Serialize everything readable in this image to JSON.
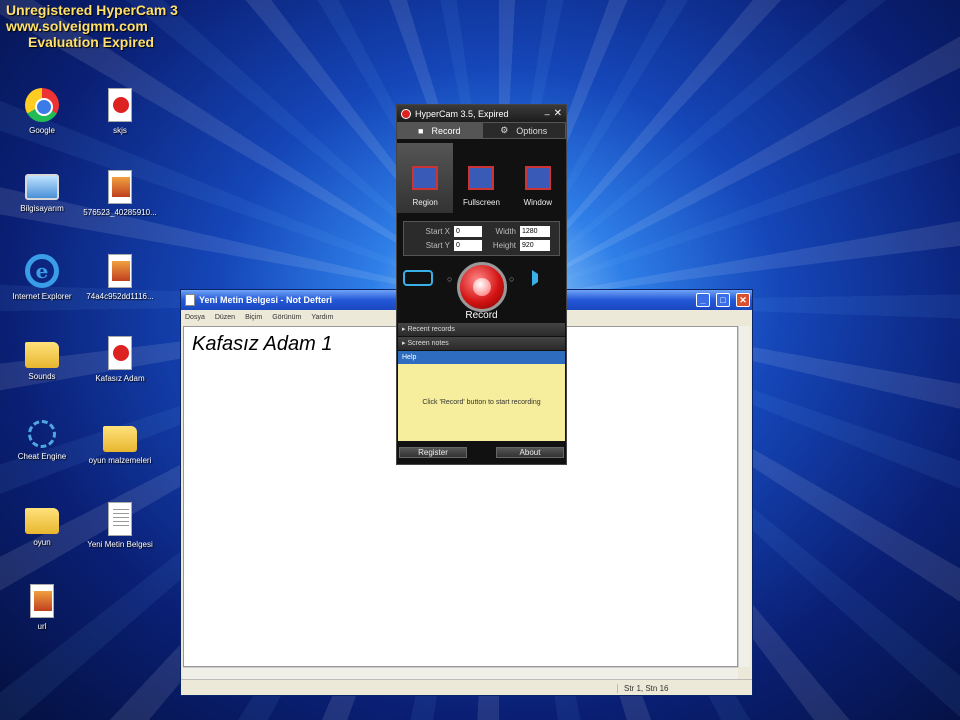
{
  "watermark": {
    "line1": "Unregistered HyperCam 3",
    "line2": "www.solveigmm.com",
    "line3": "Evaluation Expired"
  },
  "desktop": {
    "icons": [
      {
        "label": "Google",
        "icon": "chrome-icon"
      },
      {
        "label": "Bilgisayarım",
        "icon": "computer-icon"
      },
      {
        "label": "Internet Explorer",
        "icon": "ie-icon"
      },
      {
        "label": "Sounds",
        "icon": "folder-icon"
      },
      {
        "label": "Cheat Engine",
        "icon": "cheat-engine-icon"
      },
      {
        "label": "oyun",
        "icon": "folder-icon"
      },
      {
        "label": "url",
        "icon": "image-file-icon"
      },
      {
        "label": "skjs",
        "icon": "flash-file-icon"
      },
      {
        "label": "576523_40285910...",
        "icon": "image-file-icon"
      },
      {
        "label": "74a4c952dd1116...",
        "icon": "image-file-icon"
      },
      {
        "label": "Kafasız Adam",
        "icon": "flash-file-icon"
      },
      {
        "label": "oyun malzemeleri",
        "icon": "folder-icon"
      },
      {
        "label": "Yeni Metin Belgesi",
        "icon": "text-file-icon"
      }
    ]
  },
  "notepad": {
    "title": "Yeni Metin Belgesi - Not Defteri",
    "menu": [
      "Dosya",
      "Düzen",
      "Biçim",
      "Görünüm",
      "Yardım"
    ],
    "content": "Kafasız Adam 1",
    "status": "Str 1, Stn 16"
  },
  "hypercam": {
    "title": "HyperCam 3.5, Expired",
    "tabs": [
      "Record",
      "Options"
    ],
    "modes": [
      "Region",
      "Fullscreen",
      "Window"
    ],
    "coords": {
      "start_x_label": "Start X",
      "start_x": "0",
      "width_label": "Width",
      "width": "1280",
      "start_y_label": "Start Y",
      "start_y": "0",
      "height_label": "Height",
      "height": "920"
    },
    "record_label": "Record",
    "sections": [
      "Recent records",
      "Screen notes",
      "Help"
    ],
    "help_text": "Click 'Record' button to start recording",
    "register_label": "Register",
    "about_label": "About",
    "accent": "#d41414"
  }
}
